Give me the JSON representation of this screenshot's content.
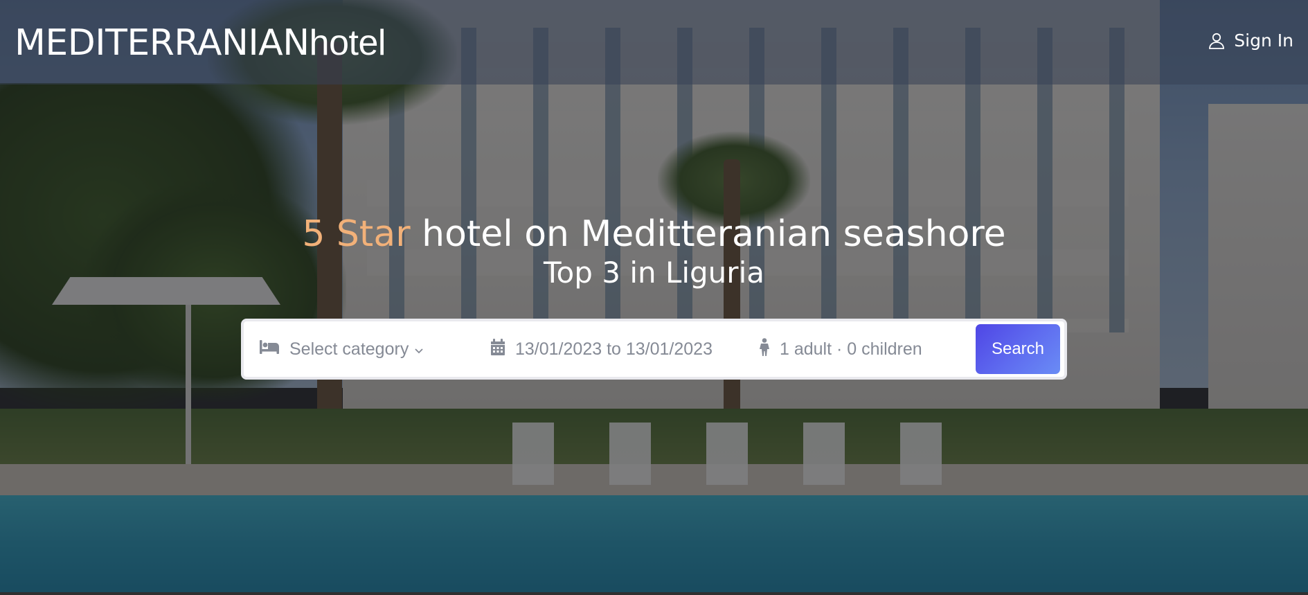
{
  "header": {
    "brand_strong": "MEDITERRANIAN",
    "brand_light": "hotel",
    "signin_label": "Sign In",
    "signin_icon": "user-icon"
  },
  "hero": {
    "title_accent": "5 Star",
    "title_rest": " hotel on Meditteranian seashore",
    "subtitle": "Top 3 in Liguria",
    "accent_color": "#f2b179"
  },
  "search": {
    "category": {
      "icon": "bed-icon",
      "value": "Select category"
    },
    "dates": {
      "icon": "calendar-icon",
      "value": "13/01/2023 to 13/01/2023"
    },
    "guests": {
      "icon": "person-icon",
      "value": "1 adult · 0 children"
    },
    "button_label": "Search",
    "button_color": "#4f46e5"
  }
}
